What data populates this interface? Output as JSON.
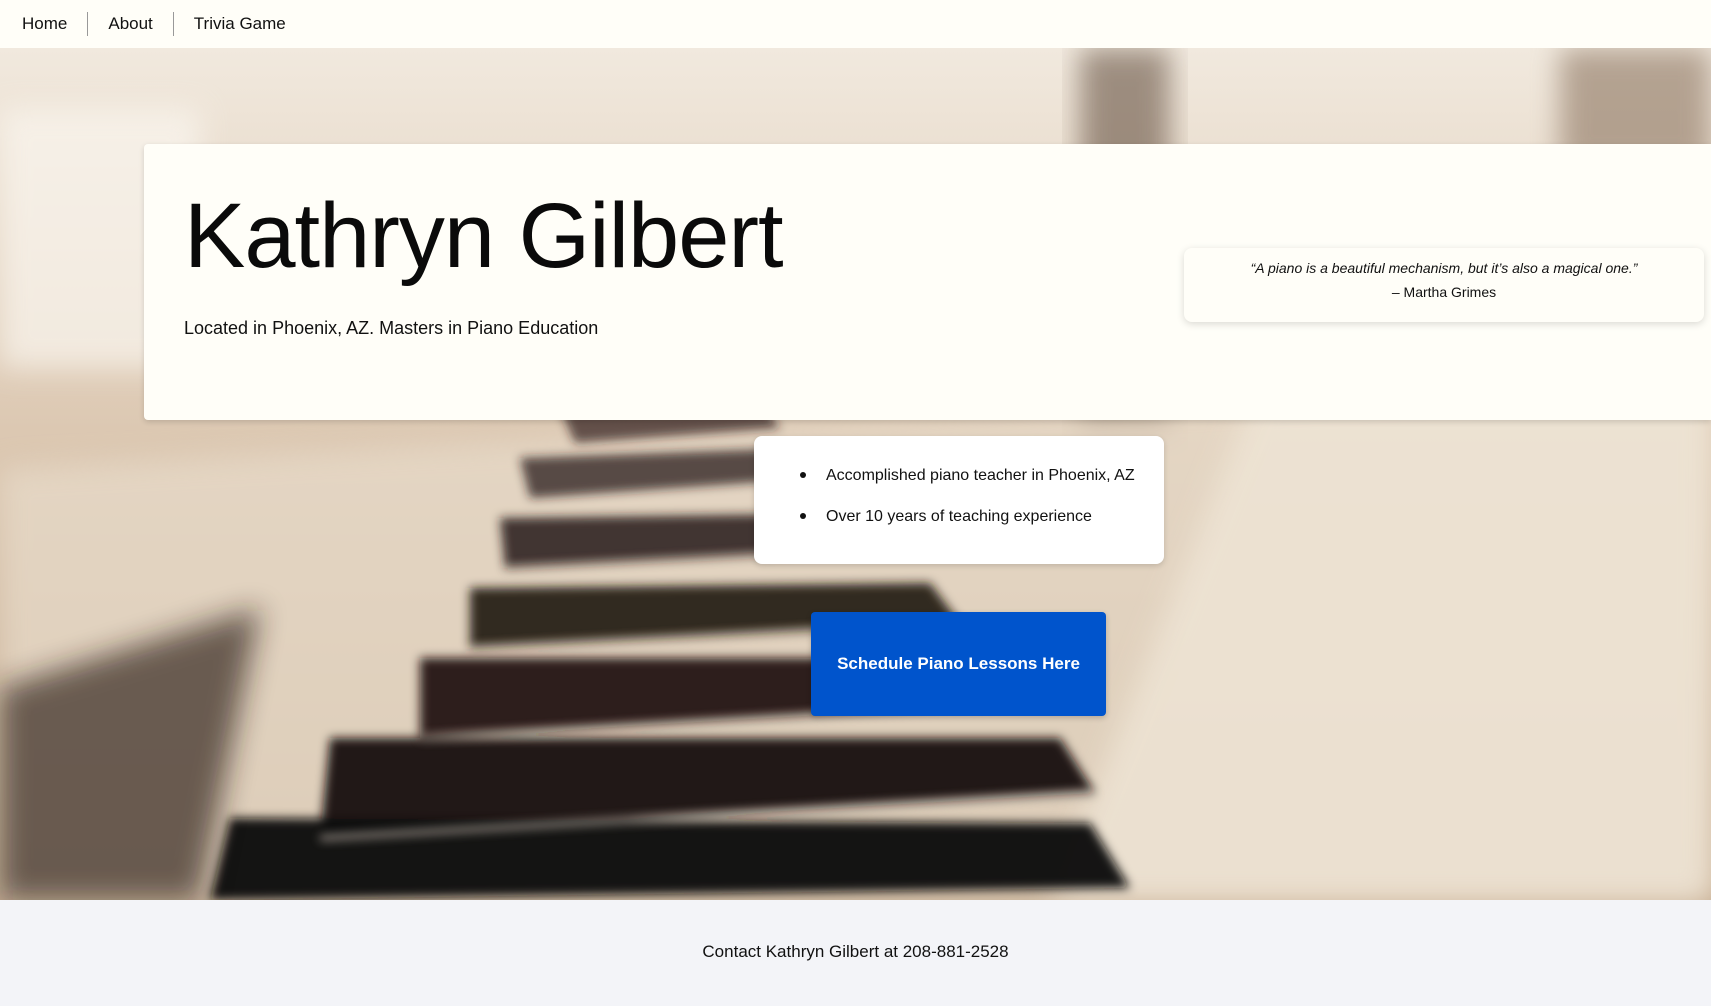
{
  "nav": {
    "items": [
      {
        "label": "Home"
      },
      {
        "label": "About"
      },
      {
        "label": "Trivia Game"
      }
    ]
  },
  "hero": {
    "title": "Kathryn Gilbert",
    "subtitle": "Located in Phoenix, AZ. Masters in Piano Education",
    "quote": {
      "text": "“A piano is a beautiful mechanism, but it’s also a magical one.”",
      "author": "– Martha Grimes"
    }
  },
  "facts": {
    "items": [
      "Accomplished piano teacher in Phoenix, AZ",
      "Over 10 years of teaching experience"
    ]
  },
  "cta": {
    "label": "Schedule Piano Lessons Here"
  },
  "footer": {
    "text": "Contact Kathryn Gilbert at 208-881-2528"
  },
  "colors": {
    "accent": "#0054cc",
    "card": "#fffef8",
    "footer_bg": "#f3f4f8"
  }
}
